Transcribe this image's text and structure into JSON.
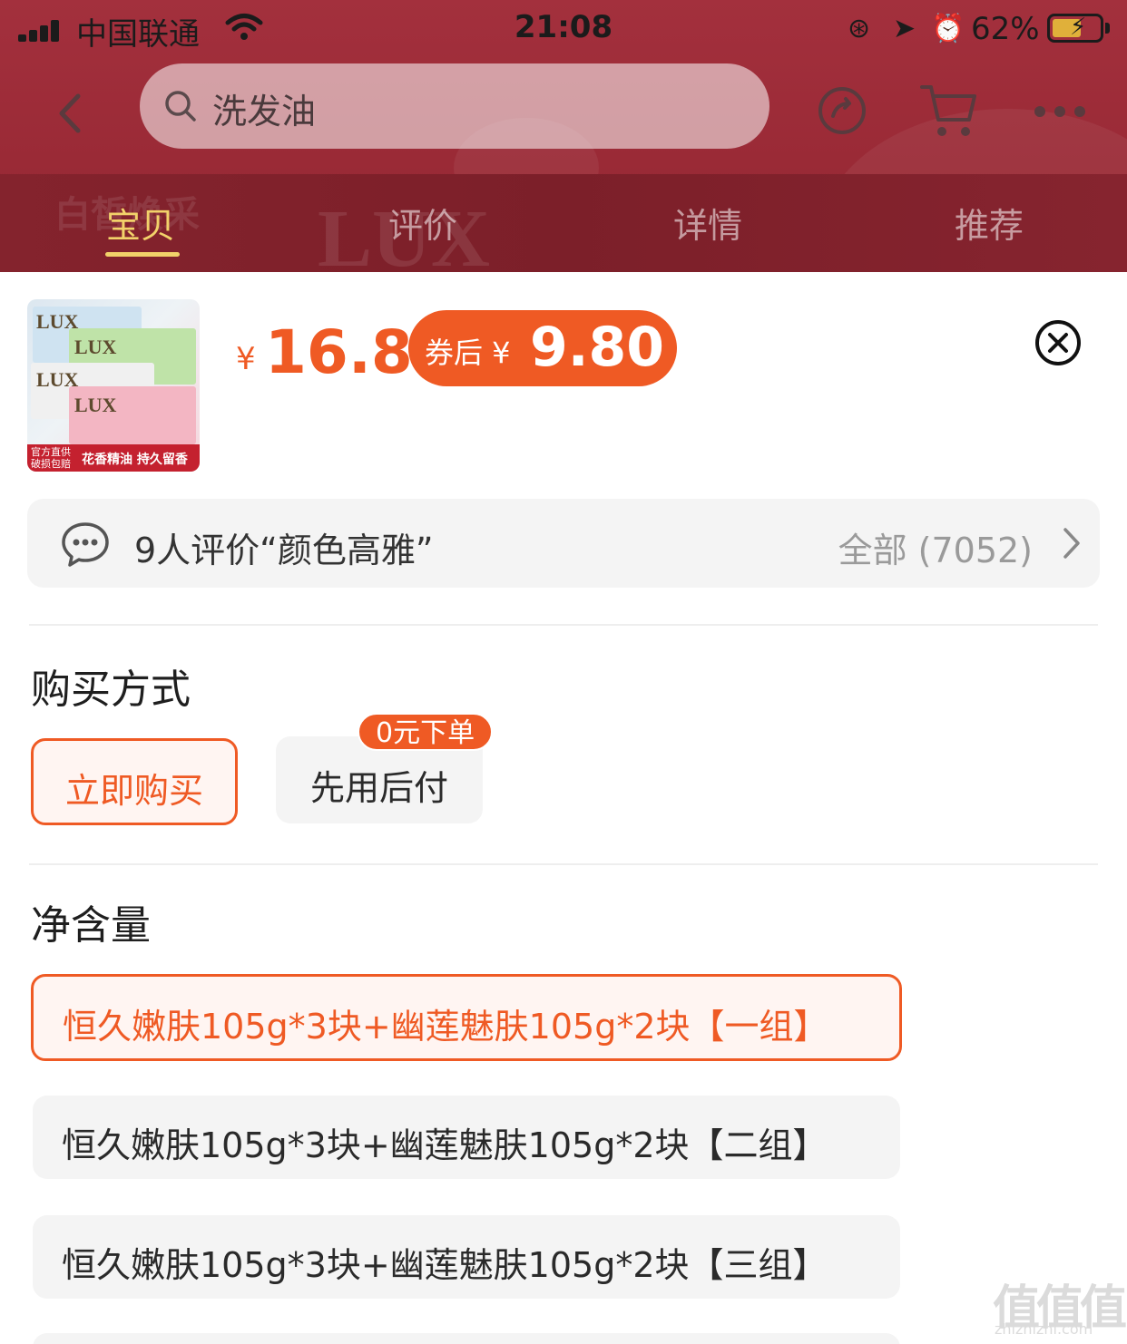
{
  "status_bar": {
    "carrier": "中国联通",
    "time": "21:08",
    "battery": "62%",
    "battery_level": 0.62
  },
  "header": {
    "search_query": "洗发油",
    "icons": [
      "back-icon",
      "search-icon",
      "share-icon",
      "cart-icon",
      "more-icon"
    ]
  },
  "tabs": [
    {
      "label": "宝贝",
      "active": true
    },
    {
      "label": "评价",
      "active": false
    },
    {
      "label": "详情",
      "active": false
    },
    {
      "label": "推荐",
      "active": false
    }
  ],
  "product": {
    "thumbnail": {
      "brand": "LUX",
      "badge_left": "官方直供 破损包赔",
      "badge_right": "花香精油 持久留香"
    },
    "currency": "¥",
    "price": "16.8",
    "coupon_label": "券后 ¥",
    "coupon_price": "9.80"
  },
  "review_summary": {
    "text": "9人评价“颜色高雅”",
    "all_label": "全部 (7052)"
  },
  "purchase_method": {
    "title": "购买方式",
    "options": [
      {
        "label": "立即购买",
        "selected": true
      },
      {
        "label": "先用后付",
        "selected": false,
        "badge": "0元下单"
      }
    ]
  },
  "net_content": {
    "title": "净含量",
    "options": [
      {
        "label": "恒久嫩肤105g*3块+幽莲魅肤105g*2块【一组】",
        "selected": true
      },
      {
        "label": "恒久嫩肤105g*3块+幽莲魅肤105g*2块【二组】",
        "selected": false
      },
      {
        "label": "恒久嫩肤105g*3块+幽莲魅肤105g*2块【三组】",
        "selected": false
      }
    ]
  },
  "watermark": {
    "mark": "值值值",
    "site": "zhizhizhi.com"
  },
  "colors": {
    "accent": "#ef5a24",
    "header_bg": "#a3303d",
    "tab_active": "#f2d26a"
  }
}
